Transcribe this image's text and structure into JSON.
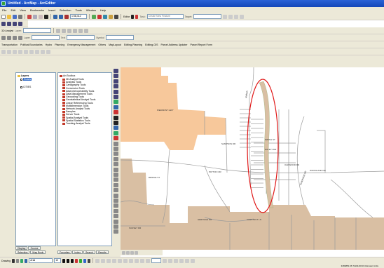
{
  "window": {
    "title": "Untitled - ArcMap - ArcEditor"
  },
  "menu": [
    "File",
    "Edit",
    "View",
    "Bookmarks",
    "Insert",
    "Selection",
    "Tools",
    "Window",
    "Help"
  ],
  "standard_toolbar": {
    "scale": "1:58,412",
    "editor_label": "Editor"
  },
  "edit_toolbar": {
    "task_label": "Task:",
    "task_value": "Create New Feature",
    "target_label": "Target:"
  },
  "georef_toolbar": {
    "label": "3D Analyst",
    "layer_label": "Layer:"
  },
  "labeling_toolbar": {
    "layer_label": "Layer",
    "text_label": "Text",
    "symbol_label": "Symbol"
  },
  "custom_toolbar": [
    "Transportation",
    "Political Boundaries",
    "Hydro",
    "Planning",
    "Emergency Management",
    "Others",
    "MapLayout",
    "Editing-Planning",
    "Editing-GIS",
    "Parcel Address Updater",
    "Parcel Report Form"
  ],
  "toc": {
    "root": "Layers",
    "items": [
      "Roads",
      "CITIES"
    ]
  },
  "toolbox": {
    "root": "ArcToolbox",
    "items": [
      "3D Analyst Tools",
      "Analysis Tools",
      "Cartography Tools",
      "Conversion Tools",
      "Data Interoperability Tools",
      "Data Management Tools",
      "Geocoding Tools",
      "Geostatistical Analyst Tools",
      "Linear Referencing Tools",
      "Multidimension Tools",
      "Network Analyst Tools",
      "Samples",
      "Server Tools",
      "Spatial Analyst Tools",
      "Spatial Statistics Tools",
      "Tracking Analyst Tools"
    ]
  },
  "toc_tabs": [
    "Display",
    "Source",
    "Selection"
  ],
  "toc_tabs2": [
    "Map Book"
  ],
  "toolbox_tabs": [
    "Favorites",
    "Index",
    "Search",
    "Results"
  ],
  "draw_toolbar": {
    "label": "Drawing",
    "font": "Arial",
    "size": "10"
  },
  "status": {
    "coords": "3469851.66  7110143.60 Unknown Units"
  },
  "colors": {
    "parcel_orange": "#f7c89b",
    "parcel_tan": "#d9bfa3",
    "road_gray": "#9a9a9a",
    "highlight_red": "#e01818"
  },
  "map_labels": [
    "PIEDMONT HWY",
    "PATTON CIR",
    "MAPLE ST",
    "HALEY AVE",
    "OAKWOOD RD",
    "RIVERSIDE DR",
    "WOODLAND DR",
    "SUNSET DR",
    "HERITAGE DR",
    "CHESTNUT LN",
    "AMBER",
    "SAMPSON DR",
    "BRIDGE ST"
  ]
}
